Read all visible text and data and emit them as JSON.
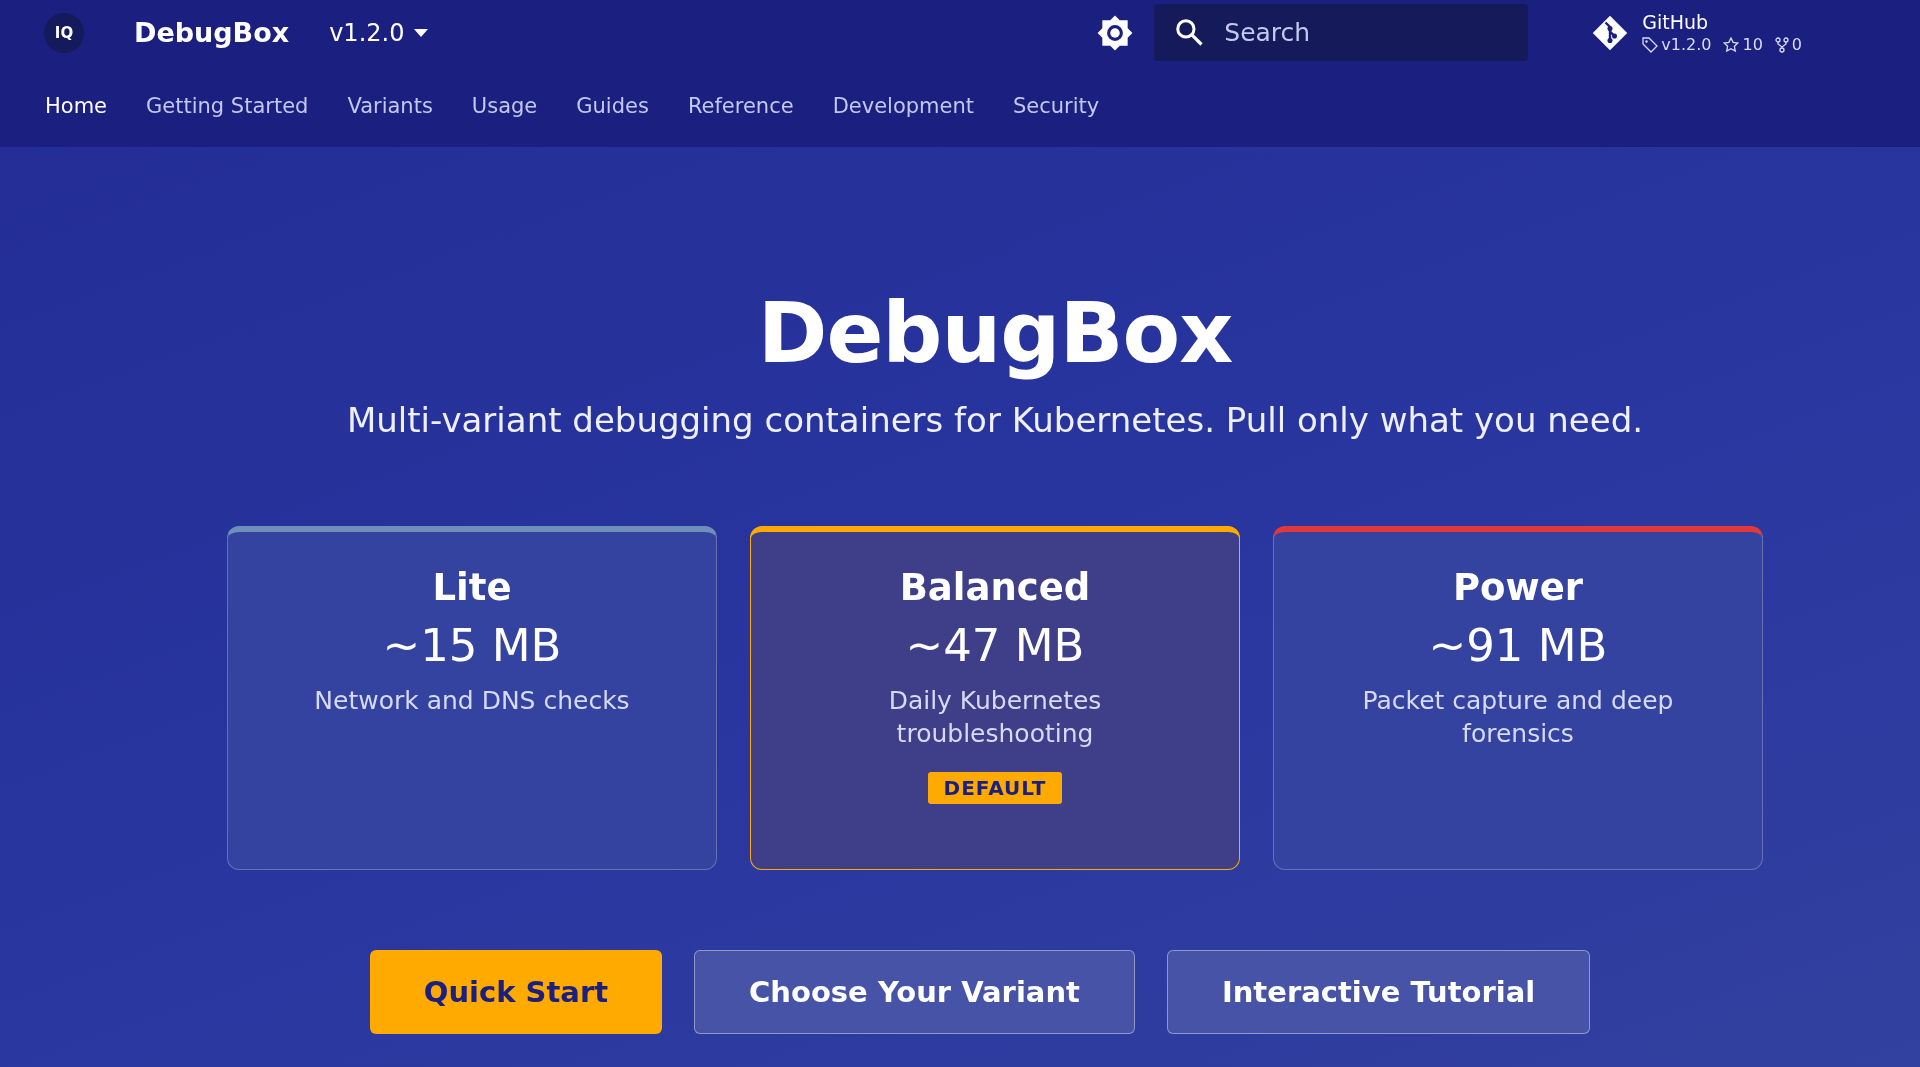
{
  "header": {
    "logo": "IQ",
    "title": "DebugBox",
    "version": "v1.2.0",
    "search": {
      "placeholder": "Search"
    },
    "repo": {
      "name": "GitHub",
      "tag": "v1.2.0",
      "stars": "10",
      "forks": "0"
    }
  },
  "nav": [
    {
      "label": "Home",
      "selected": true
    },
    {
      "label": "Getting Started",
      "selected": false
    },
    {
      "label": "Variants",
      "selected": false
    },
    {
      "label": "Usage",
      "selected": false
    },
    {
      "label": "Guides",
      "selected": false
    },
    {
      "label": "Reference",
      "selected": false
    },
    {
      "label": "Development",
      "selected": false
    },
    {
      "label": "Security",
      "selected": false
    }
  ],
  "hero": {
    "title": "DebugBox",
    "subtitle": "Multi-variant debugging containers for Kubernetes. Pull only what you need."
  },
  "variants": [
    {
      "name": "Lite",
      "size": "~15 MB",
      "description": "Network and DNS checks",
      "color": "#6f8fb8",
      "selected": false
    },
    {
      "name": "Balanced",
      "size": "~47 MB",
      "description": "Daily Kubernetes troubleshooting",
      "color": "#ffaa00",
      "selected": true,
      "badge": "DEFAULT"
    },
    {
      "name": "Power",
      "size": "~91 MB",
      "description": "Packet capture and deep forensics",
      "color": "#e0383c",
      "selected": false
    }
  ],
  "actions": [
    {
      "label": "Quick Start",
      "kind": "primary"
    },
    {
      "label": "Choose Your Variant",
      "kind": "secondary"
    },
    {
      "label": "Interactive Tutorial",
      "kind": "secondary"
    }
  ]
}
